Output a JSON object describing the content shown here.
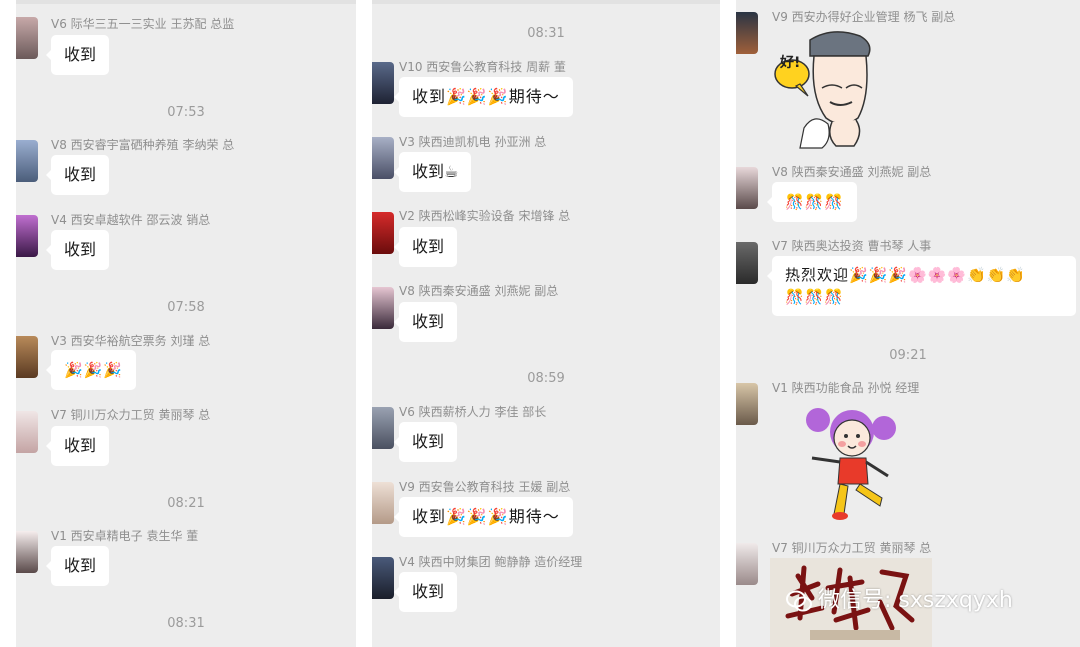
{
  "left": {
    "msg1": {
      "name": "V6 际华三五一三实业 王苏配 总监",
      "text": "收到"
    },
    "time1": "07:53",
    "msg2": {
      "name": "V8 西安睿宇富硒种养殖 李纳荣 总",
      "text": "收到"
    },
    "msg3": {
      "name": "V4 西安卓越软件 邵云波 销总",
      "text": "收到"
    },
    "time2": "07:58",
    "msg4": {
      "name": "V3 西安华裕航空票务 刘瑾 总",
      "text": "🎉🎉🎉"
    },
    "msg5": {
      "name": "V7 铜川万众力工贸 黄丽琴 总",
      "text": "收到"
    },
    "time3": "08:21",
    "msg6": {
      "name": "V1 西安卓精电子 袁生华 董",
      "text": "收到"
    },
    "time4": "08:31"
  },
  "middle": {
    "time1": "08:31",
    "msg1": {
      "name": "V10 西安鲁公教育科技 周薪 董",
      "text": "收到🎉🎉🎉期待～"
    },
    "msg2": {
      "name": "V3 陕西迪凯机电 孙亚洲 总",
      "text": "收到☕"
    },
    "msg3": {
      "name": "V2 陕西松峰实验设备 宋增锋 总",
      "text": "收到"
    },
    "msg4": {
      "name": "V8 陕西秦安通盛 刘燕妮 副总",
      "text": "收到"
    },
    "time2": "08:59",
    "msg5": {
      "name": "V6 陕西薪桥人力 李佳 部长",
      "text": "收到"
    },
    "msg6": {
      "name": "V9 西安鲁公教育科技 王媛 副总",
      "text": "收到🎉🎉🎉期待～"
    },
    "msg7": {
      "name": "V4 陕西中财集团 鲍静静 造价经理",
      "text": "收到"
    }
  },
  "right": {
    "msg1": {
      "name": "V9 西安办得好企业管理 杨飞 副总",
      "sticker_text": "好!"
    },
    "msg2": {
      "name": "V8 陕西秦安通盛 刘燕妮 副总",
      "text": "🎊🎊🎊"
    },
    "msg3": {
      "name": "V7 陕西奥达投资 曹书琴 人事",
      "text_line1": "热烈欢迎🎉🎉🎉🌸🌸🌸👏👏👏",
      "text_line2": "🎊🎊🎊"
    },
    "time1": "09:21",
    "msg4": {
      "name": "V1 陕西功能食品 孙悦 经理"
    },
    "msg5": {
      "name": "V7 铜川万众力工贸 黄丽琴 总"
    }
  },
  "watermark": {
    "text": "微信号: sxszxqyxh"
  },
  "colors": {
    "panel_bg": "#ededed",
    "bubble_bg": "#ffffff",
    "name_text": "#8f8f8f",
    "time_text": "#9b9b9b"
  }
}
